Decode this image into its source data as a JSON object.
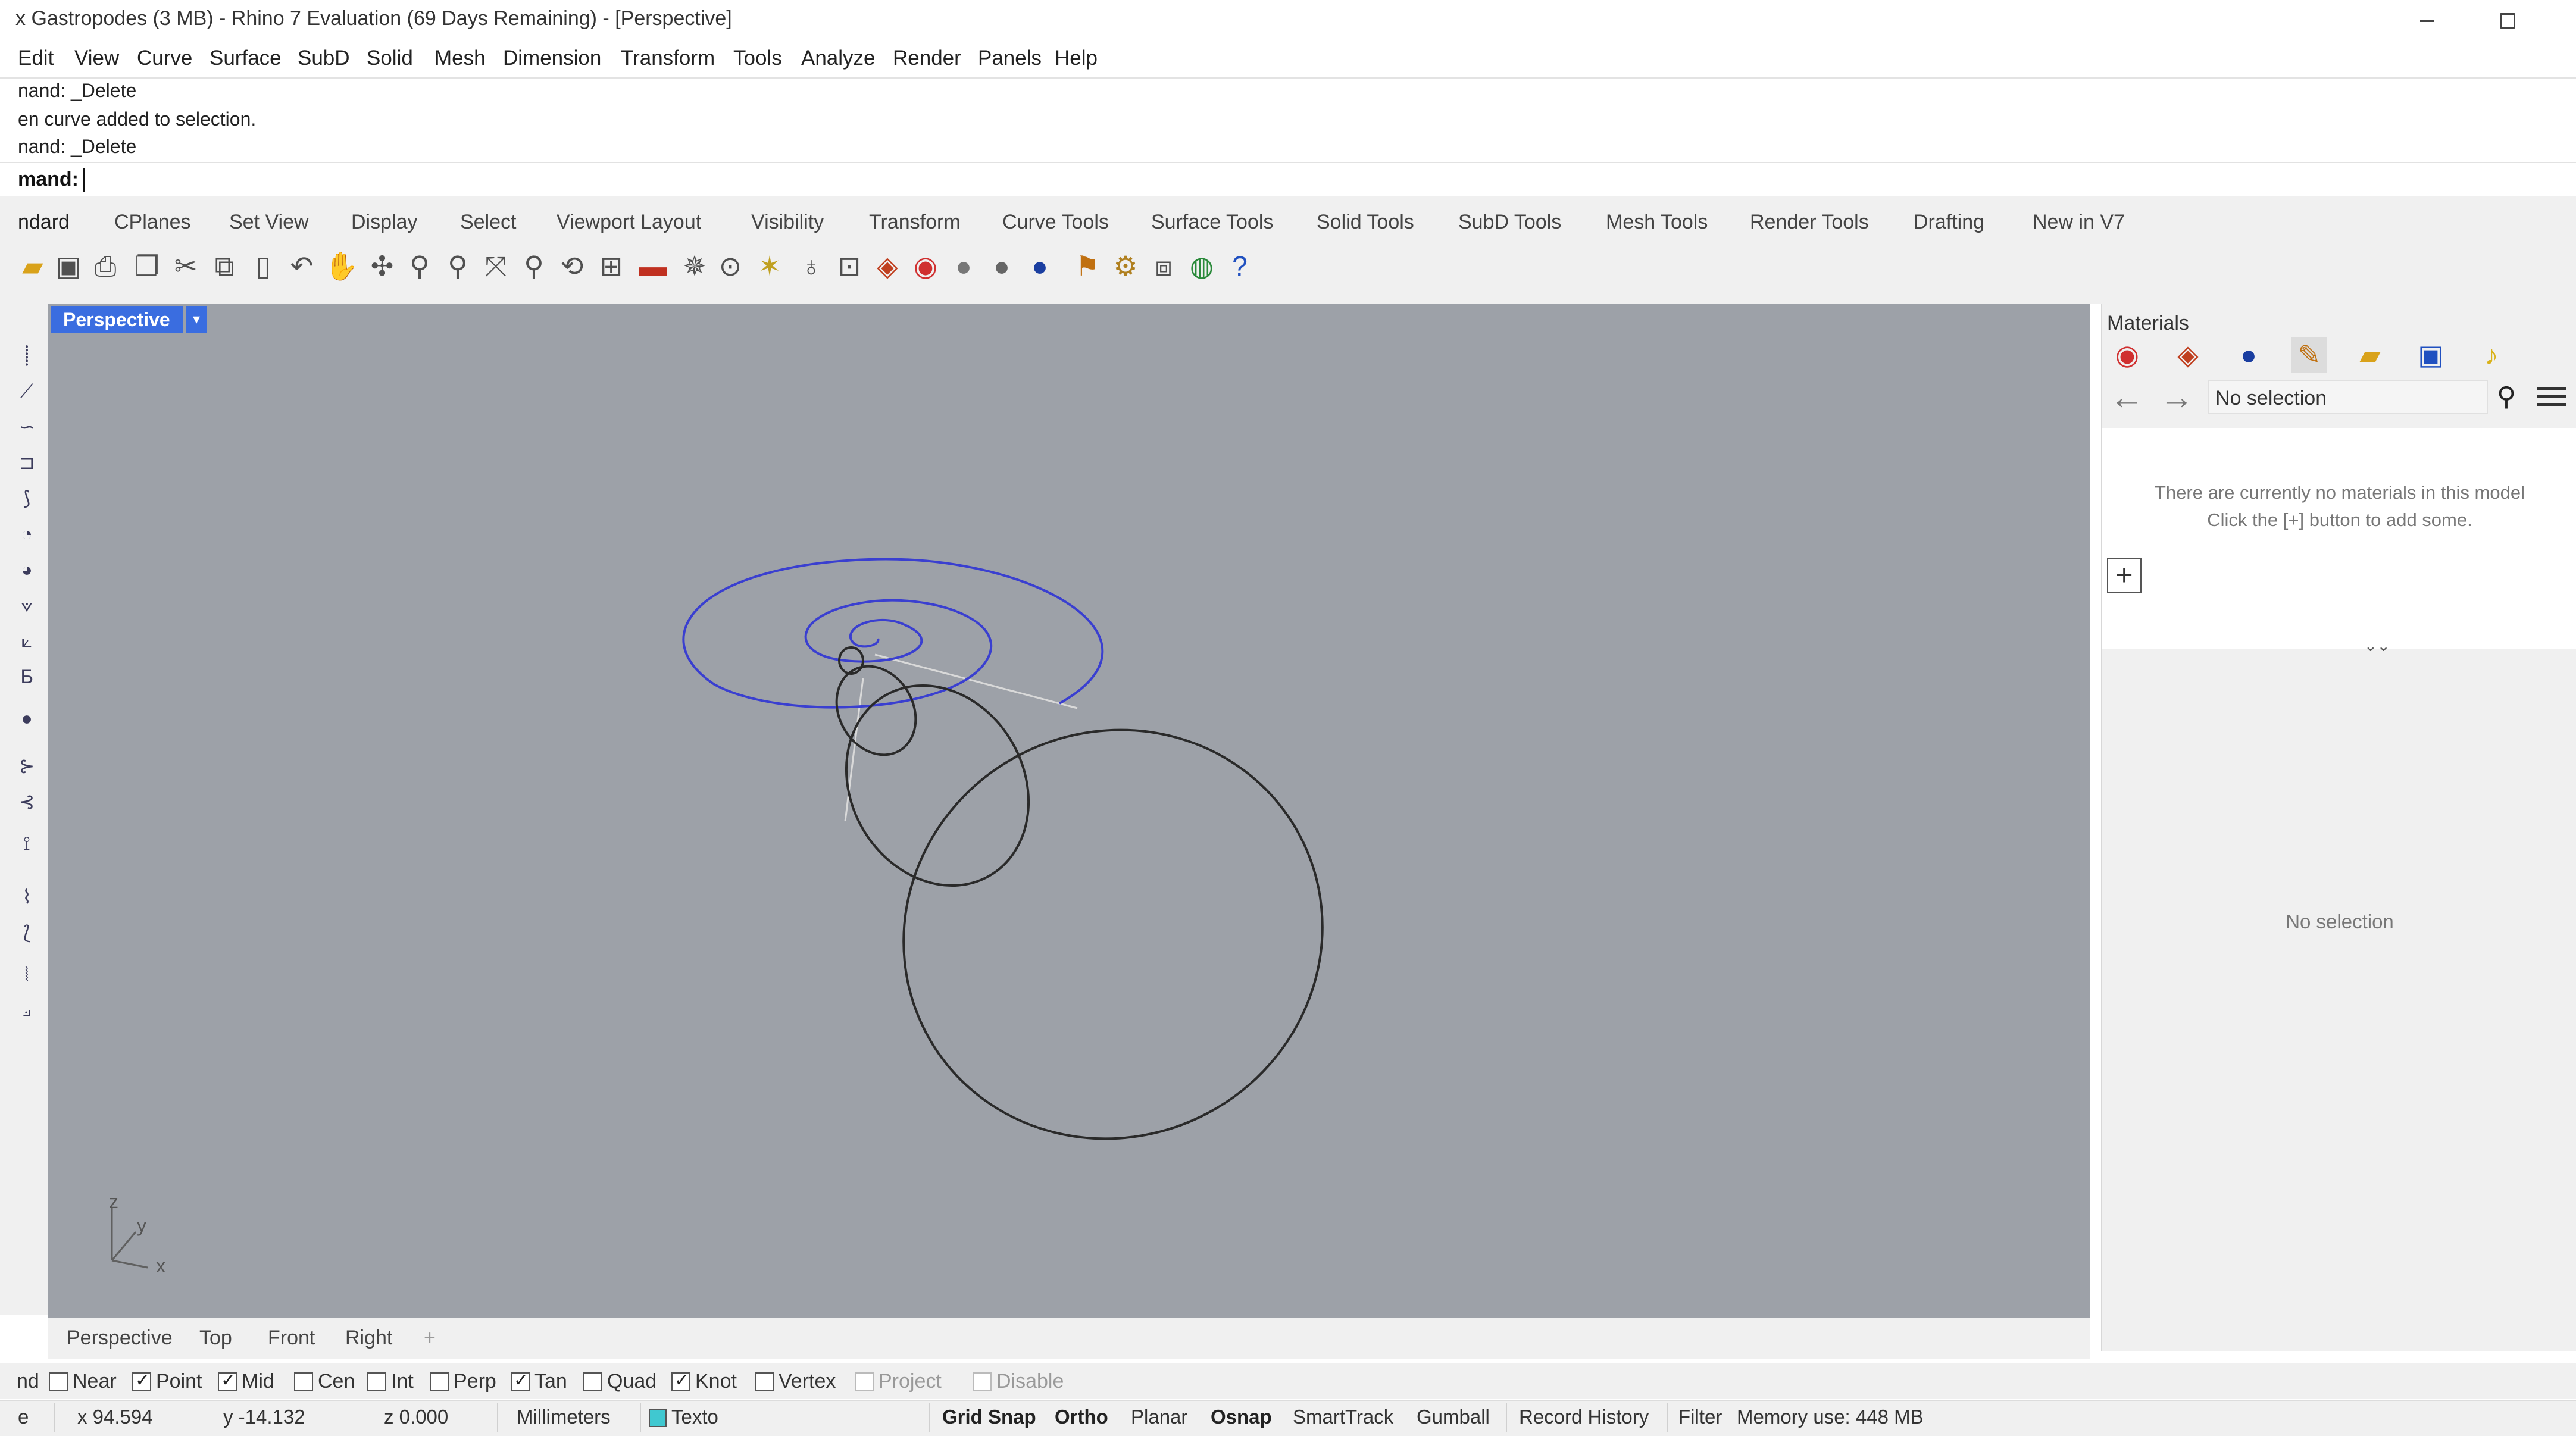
{
  "window": {
    "title": "x Gastropodes (3 MB) - Rhino 7 Evaluation (69 Days Remaining) - [Perspective]"
  },
  "menu": [
    "Edit",
    "View",
    "Curve",
    "Surface",
    "SubD",
    "Solid",
    "Mesh",
    "Dimension",
    "Transform",
    "Tools",
    "Analyze",
    "Render",
    "Panels",
    "Help"
  ],
  "command_history": [
    "nand: _Delete",
    "en curve added to selection.",
    "nand: _Delete"
  ],
  "command_prompt": "mand:",
  "toolbar_tabs": [
    "ndard",
    "CPlanes",
    "Set View",
    "Display",
    "Select",
    "Viewport Layout",
    "Visibility",
    "Transform",
    "Curve Tools",
    "Surface Tools",
    "Solid Tools",
    "SubD Tools",
    "Mesh Tools",
    "Render Tools",
    "Drafting",
    "New in V7"
  ],
  "toolbar_icons": [
    "open-icon",
    "save-icon",
    "print-icon",
    "import-icon",
    "cut-icon",
    "copy-icon",
    "paste-icon",
    "undo-icon",
    "pan-icon",
    "move-icon",
    "zoom-icon",
    "zoom-window-icon",
    "zoom-extents-icon",
    "zoom-selected-icon",
    "rotate-view-icon",
    "four-viewports-icon",
    "cplane-icon",
    "object-properties-icon",
    "snap-icon",
    "lights-icon",
    "lock-icon",
    "material-icon",
    "color-wheel-icon",
    "shaded-sphere-icon",
    "rendered-sphere-icon",
    "render-sphere-icon",
    "options-icon",
    "gear-icon",
    "link-icon",
    "globe-icon",
    "help-icon"
  ],
  "viewport": {
    "name": "Perspective",
    "dropdown": "▾",
    "axis": {
      "x": "x",
      "y": "y",
      "z": "z"
    }
  },
  "viewport_tabs": [
    "Perspective",
    "Top",
    "Front",
    "Right"
  ],
  "viewport_tab_add": "+",
  "osnap": {
    "prefix": "nd",
    "items": [
      {
        "label": "Near",
        "checked": false
      },
      {
        "label": "Point",
        "checked": true
      },
      {
        "label": "Mid",
        "checked": true
      },
      {
        "label": "Cen",
        "checked": false
      },
      {
        "label": "Int",
        "checked": false
      },
      {
        "label": "Perp",
        "checked": false
      },
      {
        "label": "Tan",
        "checked": true
      },
      {
        "label": "Quad",
        "checked": false
      },
      {
        "label": "Knot",
        "checked": true
      },
      {
        "label": "Vertex",
        "checked": false
      },
      {
        "label": "Project",
        "checked": false,
        "disabled": true
      },
      {
        "label": "Disable",
        "checked": false,
        "disabled": true
      }
    ]
  },
  "status": {
    "prefix": "e",
    "x": "x 94.594",
    "y": "y -14.132",
    "z": "z 0.000",
    "units": "Millimeters",
    "layer": "Texto",
    "layer_color": "#40c8d0",
    "grid_snap": "Grid Snap",
    "ortho": "Ortho",
    "planar": "Planar",
    "osnap": "Osnap",
    "smarttrack": "SmartTrack",
    "gumball": "Gumball",
    "record_history": "Record History",
    "filter": "Filter",
    "memory": "Memory use: 448 MB"
  },
  "materials_panel": {
    "title": "Materials",
    "search_value": "No selection",
    "empty_line1": "There are currently no materials in this model",
    "empty_line2": "Click the [+] button to add some.",
    "add_button": "+",
    "splitter": "⌄⌄",
    "no_selection": "No selection"
  },
  "colors": {
    "viewport_bg": "#9da1a8",
    "active_tab": "#3a6de0",
    "curve_blue": "#3a3fd0",
    "curve_black": "#2a2a2a"
  }
}
